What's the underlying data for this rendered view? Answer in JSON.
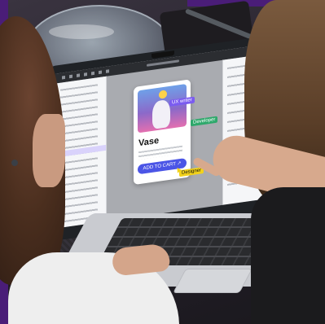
{
  "photo": {
    "colors": {
      "frame_purple": "#4a1d78",
      "table_glass": "#9aa8b4",
      "screen_bezel": "#1f2226",
      "canvas_gray": "#a9abb0",
      "panel_white": "#f5f6f8",
      "toolbar_dark": "#2b2d31",
      "card_white": "#ffffff",
      "card_art_purple": "#8b69c9",
      "tag_purple": "#7b5cf0",
      "tag_green": "#2ea86b",
      "tag_yellow": "#f2d21b",
      "button_blue": "#4b55e6",
      "keyboard_dark": "#2a2b2e",
      "laptop_silver": "#c9cbd0",
      "hair_brown": "#4a2e1e",
      "skin": "#d7a98d",
      "sweater_white": "#eeeeee",
      "top_black": "#1b1b1d"
    },
    "screen_ui": {
      "product_title": "Vase",
      "button_label": "ADD TO CART ↗",
      "tags": {
        "ux_writer": "UX writer",
        "developer": "Developer",
        "designer": "Designer"
      }
    }
  }
}
